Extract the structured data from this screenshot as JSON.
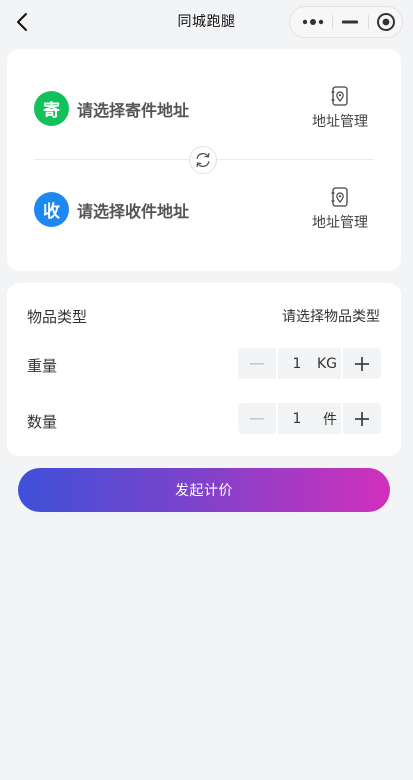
{
  "navbar": {
    "title": "同城跑腿",
    "back_icon": "chevron-left-icon",
    "capsule": {
      "more_icon": "more-dots-icon",
      "minimize_icon": "minus-icon",
      "close_icon": "target-circle-icon"
    }
  },
  "addresses": {
    "sender": {
      "badge": "寄",
      "placeholder": "请选择寄件地址",
      "manage_label": "地址管理",
      "badge_color": "#12c159"
    },
    "receiver": {
      "badge": "收",
      "placeholder": "请选择收件地址",
      "manage_label": "地址管理",
      "badge_color": "#1e88f2"
    },
    "manage_icon": "address-book-pin-icon",
    "swap_icon": "refresh-swap-icon"
  },
  "goods": {
    "type_label": "物品类型",
    "type_value": "请选择物品类型",
    "weight_label": "重量",
    "weight_value": "1",
    "weight_unit": "KG",
    "count_label": "数量",
    "count_value": "1",
    "count_unit": "件"
  },
  "submit_label": "发起计价",
  "colors": {
    "gradient_start": "#3f50d8",
    "gradient_end": "#d130bb",
    "background": "#f3f4f6"
  }
}
